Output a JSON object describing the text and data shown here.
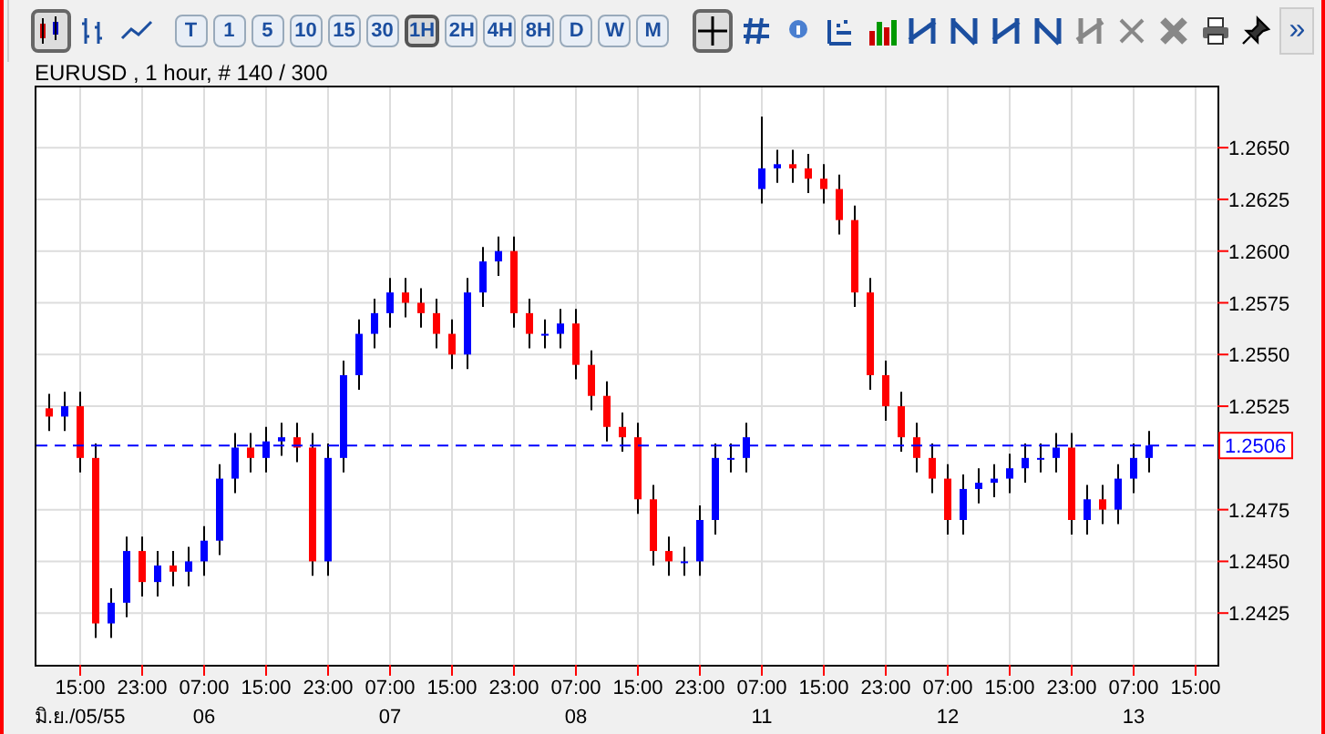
{
  "toolbar": {
    "chart_types": [
      {
        "selected": true
      },
      {
        "selected": false
      },
      {
        "selected": false
      }
    ],
    "periods": [
      {
        "label": "T",
        "selected": false
      },
      {
        "label": "1",
        "selected": false
      },
      {
        "label": "5",
        "selected": false
      },
      {
        "label": "10",
        "selected": false
      },
      {
        "label": "15",
        "selected": false
      },
      {
        "label": "30",
        "selected": false
      },
      {
        "label": "1H",
        "selected": true
      },
      {
        "label": "2H",
        "selected": false
      },
      {
        "label": "4H",
        "selected": false
      },
      {
        "label": "8H",
        "selected": false
      },
      {
        "label": "D",
        "selected": false
      },
      {
        "label": "W",
        "selected": false
      },
      {
        "label": "M",
        "selected": false
      }
    ],
    "crosshair": {
      "selected": true
    },
    "more": "»"
  },
  "chart_title": "EURUSD , 1 hour, # 140 / 300",
  "date_labels": [
    "มิ.ย./05/55",
    "06",
    "07",
    "08",
    "11",
    "12",
    "13"
  ],
  "chart_data": {
    "type": "candlestick",
    "grid": true,
    "ylim": [
      1.24,
      1.268
    ],
    "yticks": [
      {
        "value": 1.2425,
        "label": "1.2425"
      },
      {
        "value": 1.245,
        "label": "1.2450"
      },
      {
        "value": 1.2475,
        "label": "1.2475"
      },
      {
        "value": 1.2525,
        "label": "1.2525"
      },
      {
        "value": 1.255,
        "label": "1.2550"
      },
      {
        "value": 1.2575,
        "label": "1.2575"
      },
      {
        "value": 1.26,
        "label": "1.2600"
      },
      {
        "value": 1.2625,
        "label": "1.2625"
      },
      {
        "value": 1.265,
        "label": "1.2650"
      }
    ],
    "categories": [
      null,
      null,
      "15:00",
      null,
      null,
      null,
      "23:00",
      null,
      null,
      null,
      "07:00",
      null,
      null,
      null,
      "15:00",
      null,
      null,
      null,
      "23:00",
      null,
      null,
      null,
      "07:00",
      null,
      null,
      null,
      "15:00",
      null,
      null,
      null,
      "23:00",
      null,
      null,
      null,
      "07:00",
      null,
      null,
      null,
      "15:00",
      null,
      null,
      null,
      "23:00",
      null,
      null,
      null,
      "07:00",
      null,
      null,
      null,
      "15:00",
      null,
      null,
      null,
      "23:00",
      null,
      null,
      null,
      "07:00",
      null,
      null,
      null,
      "15:00",
      null,
      null,
      null,
      "23:00",
      null,
      null,
      null,
      "07:00",
      null,
      null,
      null,
      "15:00"
    ],
    "ohlc": [
      [
        1.2524,
        1.2531,
        1.2513,
        1.252
      ],
      [
        1.252,
        1.2532,
        1.2513,
        1.2525
      ],
      [
        1.2525,
        1.2532,
        1.2493,
        1.25
      ],
      [
        1.25,
        1.2507,
        1.2413,
        1.242
      ],
      [
        1.242,
        1.2437,
        1.2413,
        1.243
      ],
      [
        1.243,
        1.2462,
        1.2423,
        1.2455
      ],
      [
        1.2455,
        1.2462,
        1.2433,
        1.244
      ],
      [
        1.244,
        1.2455,
        1.2433,
        1.2448
      ],
      [
        1.2448,
        1.2455,
        1.2438,
        1.2445
      ],
      [
        1.2445,
        1.2457,
        1.2438,
        1.245
      ],
      [
        1.245,
        1.2467,
        1.2443,
        1.246
      ],
      [
        1.246,
        1.2497,
        1.2453,
        1.249
      ],
      [
        1.249,
        1.2512,
        1.2483,
        1.2505
      ],
      [
        1.2505,
        1.2512,
        1.2493,
        1.25
      ],
      [
        1.25,
        1.2515,
        1.2493,
        1.2508
      ],
      [
        1.2508,
        1.2517,
        1.2501,
        1.251
      ],
      [
        1.251,
        1.2517,
        1.2498,
        1.2505
      ],
      [
        1.2505,
        1.2512,
        1.2443,
        1.245
      ],
      [
        1.245,
        1.2507,
        1.2443,
        1.25
      ],
      [
        1.25,
        1.2547,
        1.2493,
        1.254
      ],
      [
        1.254,
        1.2567,
        1.2533,
        1.256
      ],
      [
        1.256,
        1.2577,
        1.2553,
        1.257
      ],
      [
        1.257,
        1.2587,
        1.2563,
        1.258
      ],
      [
        1.258,
        1.2587,
        1.2568,
        1.2575
      ],
      [
        1.2575,
        1.2582,
        1.2563,
        1.257
      ],
      [
        1.257,
        1.2577,
        1.2553,
        1.256
      ],
      [
        1.256,
        1.2567,
        1.2543,
        1.255
      ],
      [
        1.255,
        1.2587,
        1.2543,
        1.258
      ],
      [
        1.258,
        1.2602,
        1.2573,
        1.2595
      ],
      [
        1.2595,
        1.2607,
        1.2588,
        1.26
      ],
      [
        1.26,
        1.2607,
        1.2563,
        1.257
      ],
      [
        1.257,
        1.2577,
        1.2553,
        1.256
      ],
      [
        1.256,
        1.2567,
        1.2553,
        1.256
      ],
      [
        1.256,
        1.2572,
        1.2553,
        1.2565
      ],
      [
        1.2565,
        1.2572,
        1.2538,
        1.2545
      ],
      [
        1.2545,
        1.2552,
        1.2523,
        1.253
      ],
      [
        1.253,
        1.2537,
        1.2508,
        1.2515
      ],
      [
        1.2515,
        1.2522,
        1.2503,
        1.251
      ],
      [
        1.251,
        1.2517,
        1.2473,
        1.248
      ],
      [
        1.248,
        1.2487,
        1.2448,
        1.2455
      ],
      [
        1.2455,
        1.2462,
        1.2443,
        1.245
      ],
      [
        1.245,
        1.2457,
        1.2443,
        1.245
      ],
      [
        1.245,
        1.2477,
        1.2443,
        1.247
      ],
      [
        1.247,
        1.2507,
        1.2463,
        1.25
      ],
      [
        1.25,
        1.2507,
        1.2493,
        1.25
      ],
      [
        1.25,
        1.2517,
        1.2493,
        1.251
      ],
      [
        1.263,
        1.2665,
        1.2623,
        1.264
      ],
      [
        1.264,
        1.2649,
        1.2633,
        1.2642
      ],
      [
        1.2642,
        1.2649,
        1.2633,
        1.264
      ],
      [
        1.264,
        1.2647,
        1.2628,
        1.2635
      ],
      [
        1.2635,
        1.2642,
        1.2623,
        1.263
      ],
      [
        1.263,
        1.2637,
        1.2608,
        1.2615
      ],
      [
        1.2615,
        1.2622,
        1.2573,
        1.258
      ],
      [
        1.258,
        1.2587,
        1.2533,
        1.254
      ],
      [
        1.254,
        1.2547,
        1.2518,
        1.2525
      ],
      [
        1.2525,
        1.2532,
        1.2503,
        1.251
      ],
      [
        1.251,
        1.2517,
        1.2493,
        1.25
      ],
      [
        1.25,
        1.2507,
        1.2483,
        1.249
      ],
      [
        1.249,
        1.2497,
        1.2463,
        1.247
      ],
      [
        1.247,
        1.2492,
        1.2463,
        1.2485
      ],
      [
        1.2485,
        1.2495,
        1.2478,
        1.2488
      ],
      [
        1.2488,
        1.2497,
        1.2481,
        1.249
      ],
      [
        1.249,
        1.2502,
        1.2483,
        1.2495
      ],
      [
        1.2495,
        1.2507,
        1.2488,
        1.25
      ],
      [
        1.25,
        1.2507,
        1.2493,
        1.25
      ],
      [
        1.25,
        1.2512,
        1.2493,
        1.2505
      ],
      [
        1.2505,
        1.2512,
        1.2463,
        1.247
      ],
      [
        1.247,
        1.2487,
        1.2463,
        1.248
      ],
      [
        1.248,
        1.2487,
        1.2468,
        1.2475
      ],
      [
        1.2475,
        1.2497,
        1.2468,
        1.249
      ],
      [
        1.249,
        1.2507,
        1.2483,
        1.25
      ],
      [
        1.25,
        1.2513,
        1.2493,
        1.2506
      ],
      null,
      null,
      null
    ],
    "ref_lines": [
      {
        "axis": "y",
        "value": 1.2506,
        "label": "1.2506",
        "color": "#0000ff"
      }
    ]
  }
}
